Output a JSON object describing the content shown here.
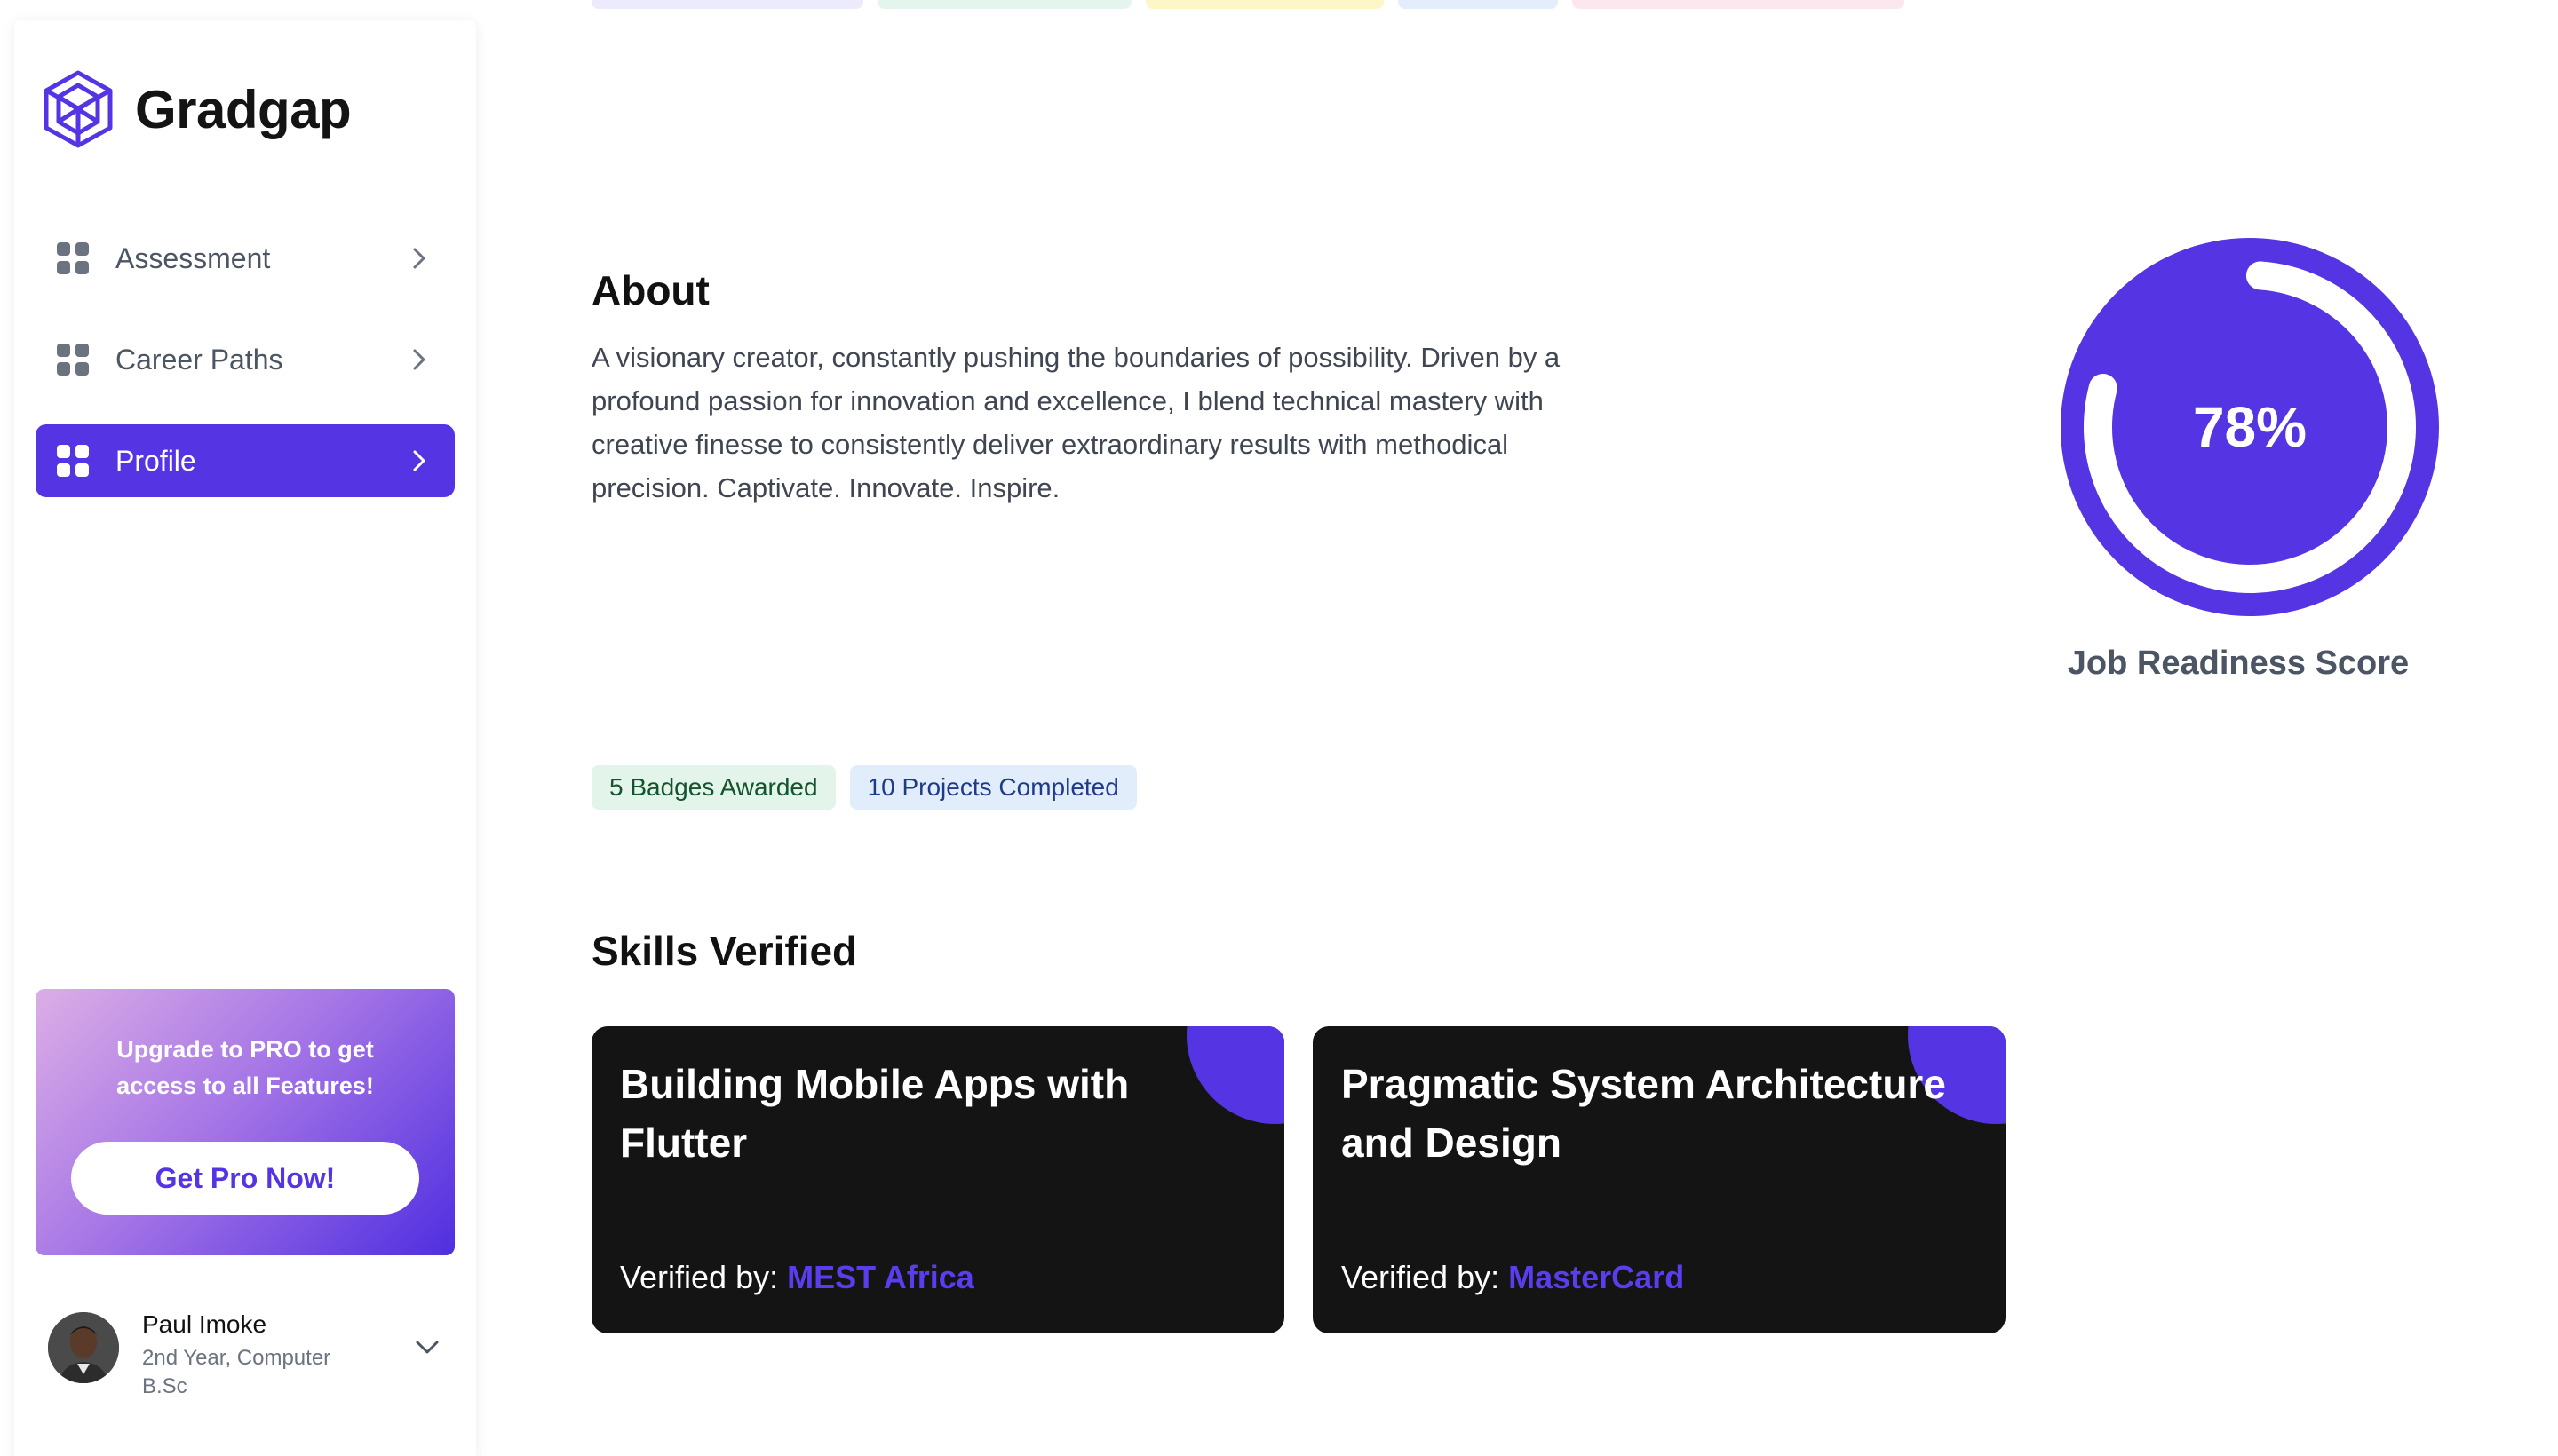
{
  "app": {
    "name": "Gradgap"
  },
  "nav": {
    "items": [
      {
        "label": "Assessment",
        "active": false
      },
      {
        "label": "Career Paths",
        "active": false
      },
      {
        "label": "Profile",
        "active": true
      }
    ]
  },
  "promo": {
    "text": "Upgrade to PRO to get access to all Features!",
    "button_label": "Get Pro Now!"
  },
  "user": {
    "name": "Paul Imoke",
    "subtitle": "2nd Year, Computer B.Sc"
  },
  "top_tags": {
    "colors": [
      "#ecebfd",
      "#e3f5ec",
      "#fdf6c6",
      "#e3edfb",
      "#fde7ee"
    ]
  },
  "about": {
    "title": "About",
    "text": "A visionary creator, constantly pushing the boundaries of possibility. Driven by a profound passion for innovation and excellence, I blend technical mastery with creative finesse to consistently deliver extraordinary results with methodical precision. Captivate. Innovate. Inspire."
  },
  "badges": [
    {
      "label": "5 Badges Awarded",
      "style": "green"
    },
    {
      "label": "10 Projects Completed",
      "style": "blue"
    }
  ],
  "skills": {
    "title": "Skills Verified",
    "verified_prefix": "Verified by: ",
    "cards": [
      {
        "title": "Building Mobile Apps with Flutter",
        "org": "MEST Africa"
      },
      {
        "title": "Pragmatic System Architecture and Design",
        "org": "MasterCard"
      }
    ]
  },
  "score": {
    "value_label": "78%",
    "value": 0.78,
    "label": "Job Readiness Score"
  },
  "colors": {
    "accent": "#5534e3",
    "card_bg": "#141414"
  }
}
